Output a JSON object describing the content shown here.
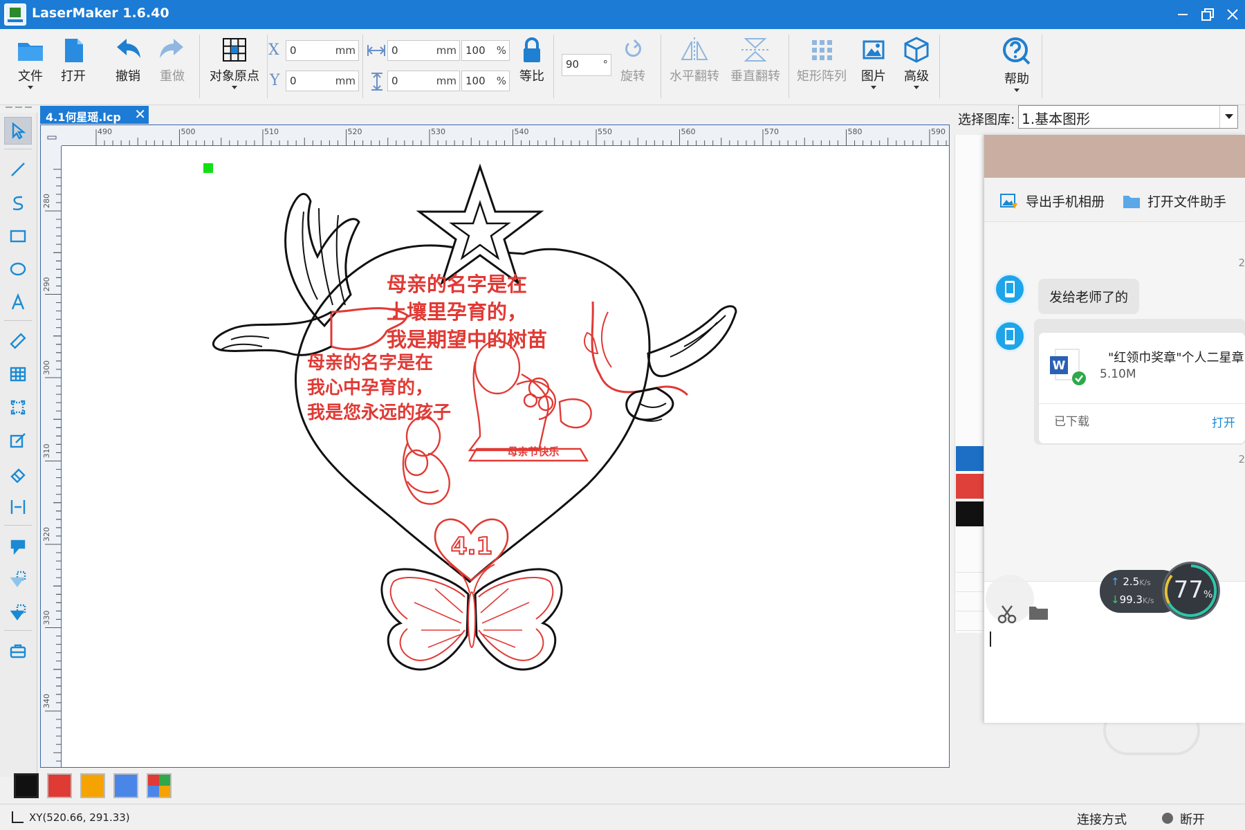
{
  "window": {
    "title": "LaserMaker 1.6.40"
  },
  "toolbar": {
    "file": "文件",
    "open": "打开",
    "undo": "撤销",
    "redo": "重做",
    "origin": "对象原点",
    "x_label": "X",
    "y_label": "Y",
    "x_value": "0",
    "y_value": "0",
    "unit_mm": "mm",
    "width_value": "0",
    "height_value": "0",
    "width_pct": "100",
    "height_pct": "100",
    "unit_pct": "%",
    "lock_ratio": "等比",
    "rotate_value": "90",
    "rotate_unit": "°",
    "rotate": "旋转",
    "flip_h": "水平翻转",
    "flip_v": "垂直翻转",
    "array": "矩形阵列",
    "image": "图片",
    "advanced": "高级",
    "help": "帮助"
  },
  "document": {
    "tab_name": "4.1何星瑶.lcp",
    "close": "✕"
  },
  "ruler": {
    "top": [
      "490",
      "500",
      "510",
      "520",
      "530",
      "540",
      "550",
      "560",
      "570",
      "580",
      "590"
    ],
    "left": [
      "280",
      "290",
      "300",
      "310",
      "320",
      "330",
      "340"
    ]
  },
  "design": {
    "text_line1": "母亲的名字是在",
    "text_line2": "土壤里孕育的，",
    "text_line3": "我是期望中的树苗",
    "text_line4": "母亲的名字是在",
    "text_line5": "我心中孕育的，",
    "text_line6": "我是您永远的孩子",
    "heart_label": "4.1",
    "banner": "母亲节快乐"
  },
  "palette": {
    "colors": [
      "#111111",
      "#e03a35",
      "#f5a300",
      "#4a86e8",
      "multi"
    ]
  },
  "status": {
    "coords": "XY(520.66, 291.33)",
    "connection_label": "连接方式",
    "connection_state": "断开"
  },
  "library": {
    "label": "选择图库:",
    "selected": "1.基本图形",
    "colors": [
      "#1c6fc4",
      "#e0403a",
      "#111111"
    ]
  },
  "chat": {
    "action_export": "导出手机相册",
    "action_open_helper": "打开文件助手",
    "time_partial": "2",
    "message": "发给老师了的",
    "file_name": "\"红领巾奖章\"个人二星章",
    "file_size": "5.10M",
    "file_status": "已下载",
    "file_open": "打开",
    "speed_up": "2.5",
    "speed_down": "99.3",
    "speed_unit": "K/s",
    "cpu_percent": "77",
    "cpu_unit": "%"
  }
}
